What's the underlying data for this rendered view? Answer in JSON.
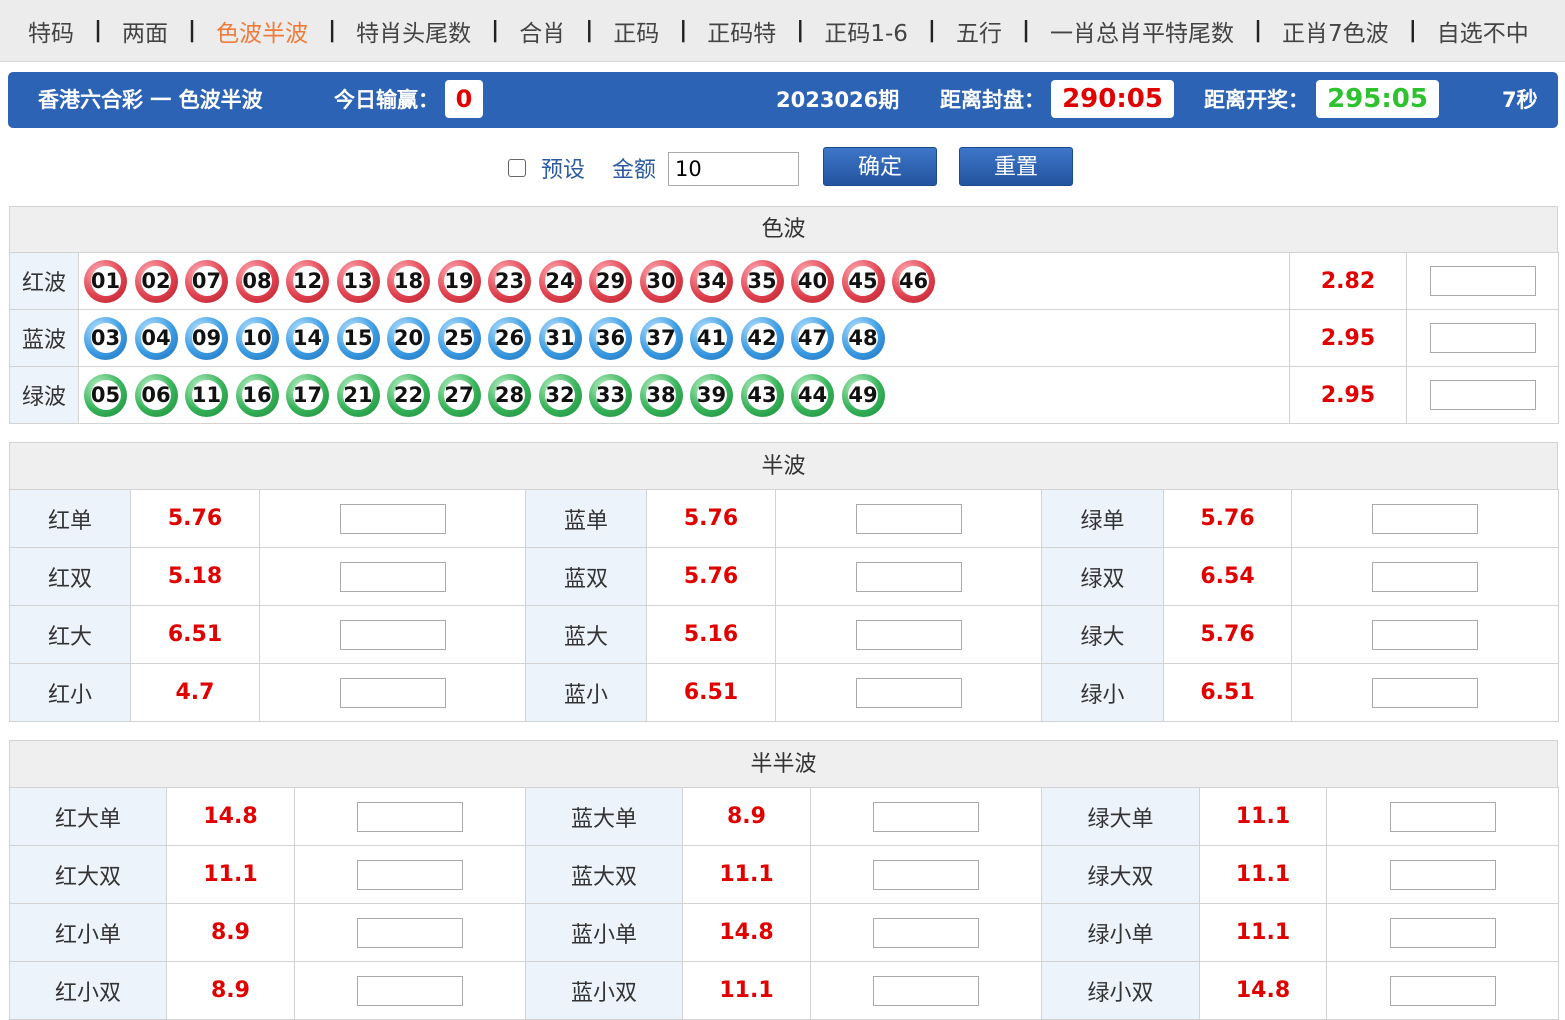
{
  "nav": {
    "items": [
      "特码",
      "两面",
      "色波半波",
      "特肖头尾数",
      "合肖",
      "正码",
      "正码特",
      "正码1-6",
      "五行",
      "一肖总肖平特尾数",
      "正肖7色波",
      "自选不中"
    ],
    "active_index": 2
  },
  "header": {
    "title": "香港六合彩 一 色波半波",
    "win_label": "今日输赢：",
    "win_value": "0",
    "period": "2023026期",
    "close_label": "距离封盘：",
    "close_time": "290:05",
    "draw_label": "距离开奖：",
    "draw_time": "295:05",
    "refresh": "7秒"
  },
  "toolbar": {
    "preset_label": "预设",
    "amount_label": "金额",
    "amount_value": "10",
    "confirm_label": "确定",
    "reset_label": "重置"
  },
  "colors": {
    "red": "#e0424f",
    "blue": "#3a9be2",
    "green": "#35b258",
    "odds": "#e00000",
    "header": "#2c63b4",
    "nav_active": "#f07a3a"
  },
  "sebo": {
    "title": "色波",
    "rows": [
      {
        "label": "红波",
        "color": "red",
        "odds": "2.82",
        "balls": [
          "01",
          "02",
          "07",
          "08",
          "12",
          "13",
          "18",
          "19",
          "23",
          "24",
          "29",
          "30",
          "34",
          "35",
          "40",
          "45",
          "46"
        ]
      },
      {
        "label": "蓝波",
        "color": "blue",
        "odds": "2.95",
        "balls": [
          "03",
          "04",
          "09",
          "10",
          "14",
          "15",
          "20",
          "25",
          "26",
          "31",
          "36",
          "37",
          "41",
          "42",
          "47",
          "48"
        ]
      },
      {
        "label": "绿波",
        "color": "green",
        "odds": "2.95",
        "balls": [
          "05",
          "06",
          "11",
          "16",
          "17",
          "21",
          "22",
          "27",
          "28",
          "32",
          "33",
          "38",
          "39",
          "43",
          "44",
          "49"
        ]
      }
    ]
  },
  "banbo": {
    "title": "半波",
    "rows": [
      [
        {
          "label": "红单",
          "odds": "5.76"
        },
        {
          "label": "蓝单",
          "odds": "5.76"
        },
        {
          "label": "绿单",
          "odds": "5.76"
        }
      ],
      [
        {
          "label": "红双",
          "odds": "5.18"
        },
        {
          "label": "蓝双",
          "odds": "5.76"
        },
        {
          "label": "绿双",
          "odds": "6.54"
        }
      ],
      [
        {
          "label": "红大",
          "odds": "6.51"
        },
        {
          "label": "蓝大",
          "odds": "5.16"
        },
        {
          "label": "绿大",
          "odds": "5.76"
        }
      ],
      [
        {
          "label": "红小",
          "odds": "4.7"
        },
        {
          "label": "蓝小",
          "odds": "6.51"
        },
        {
          "label": "绿小",
          "odds": "6.51"
        }
      ]
    ]
  },
  "banbanbo": {
    "title": "半半波",
    "rows": [
      [
        {
          "label": "红大单",
          "odds": "14.8"
        },
        {
          "label": "蓝大单",
          "odds": "8.9"
        },
        {
          "label": "绿大单",
          "odds": "11.1"
        }
      ],
      [
        {
          "label": "红大双",
          "odds": "11.1"
        },
        {
          "label": "蓝大双",
          "odds": "11.1"
        },
        {
          "label": "绿大双",
          "odds": "11.1"
        }
      ],
      [
        {
          "label": "红小单",
          "odds": "8.9"
        },
        {
          "label": "蓝小单",
          "odds": "14.8"
        },
        {
          "label": "绿小单",
          "odds": "11.1"
        }
      ],
      [
        {
          "label": "红小双",
          "odds": "8.9"
        },
        {
          "label": "蓝小双",
          "odds": "11.1"
        },
        {
          "label": "绿小双",
          "odds": "14.8"
        }
      ]
    ]
  }
}
